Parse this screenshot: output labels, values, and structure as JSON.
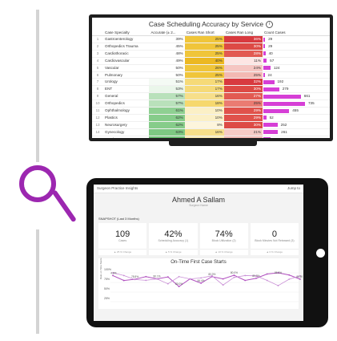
{
  "monitor": {
    "title": "Case Scheduling Accuracy by Service",
    "columns": [
      "Case Specialty",
      "Accurate (± 2...",
      "Cases Ran Short",
      "Cases Ran Long",
      "Count Cases"
    ],
    "rows": [
      {
        "idx": "1",
        "name": "Gastroenterology",
        "acc": "39%",
        "short": "25%",
        "long": "36%",
        "count": "29",
        "acc_c": "#ffffff",
        "short_c": "#f0c53a",
        "long_c": "#d83a3f",
        "bar": 0.04
      },
      {
        "idx": "2",
        "name": "Orthopedics Trauma",
        "acc": "45%",
        "short": "25%",
        "long": "30%",
        "count": "29",
        "acc_c": "#ffffff",
        "short_c": "#f0c53a",
        "long_c": "#dd4a45",
        "bar": 0.04
      },
      {
        "idx": "3",
        "name": "Cardiothoracic",
        "acc": "48%",
        "short": "25%",
        "long": "28%",
        "count": "40",
        "acc_c": "#ffffff",
        "short_c": "#f0c53a",
        "long_c": "#e25a52",
        "bar": 0.05
      },
      {
        "idx": "4",
        "name": "Cardiovascular",
        "acc": "49%",
        "short": "40%",
        "long": "11%",
        "count": "57",
        "acc_c": "#ffffff",
        "short_c": "#ecb822",
        "long_c": "#fde6e4",
        "bar": 0.08
      },
      {
        "idx": "5",
        "name": "Vascular",
        "short": "26%",
        "acc": "50%",
        "long": "24%",
        "count": "124",
        "acc_c": "#ffffff",
        "short_c": "#f0c53a",
        "long_c": "#f5c6c2",
        "bar": 0.17
      },
      {
        "idx": "6",
        "name": "Pulmonary",
        "acc": "50%",
        "short": "25%",
        "long": "25%",
        "count": "24",
        "acc_c": "#ffffff",
        "short_c": "#f0c53a",
        "long_c": "#f3b9b3",
        "bar": 0.03
      },
      {
        "idx": "7",
        "name": "Urology",
        "acc": "51%",
        "short": "17%",
        "long": "32%",
        "count": "192",
        "acc_c": "#f4faf4",
        "short_c": "#f6da78",
        "long_c": "#d83a3f",
        "bar": 0.26
      },
      {
        "idx": "8",
        "name": "ENT",
        "acc": "53%",
        "short": "17%",
        "long": "30%",
        "count": "279",
        "acc_c": "#eaf6ea",
        "short_c": "#f6da78",
        "long_c": "#dd4a45",
        "bar": 0.38
      },
      {
        "idx": "9",
        "name": "General",
        "acc": "57%",
        "short": "16%",
        "long": "27%",
        "count": "661",
        "acc_c": "#b9e1bb",
        "short_c": "#f7df8a",
        "long_c": "#e25a52",
        "bar": 0.9
      },
      {
        "idx": "10",
        "name": "Orthopedics",
        "acc": "57%",
        "short": "18%",
        "long": "25%",
        "count": "735",
        "acc_c": "#b9e1bb",
        "short_c": "#f6d86e",
        "long_c": "#ea7b72",
        "bar": 1.0
      },
      {
        "idx": "11",
        "name": "Ophthalmology",
        "acc": "61%",
        "short": "10%",
        "long": "29%",
        "count": "455",
        "acc_c": "#8fd092",
        "short_c": "#fbf0c6",
        "long_c": "#e0524b",
        "bar": 0.62
      },
      {
        "idx": "12",
        "name": "Plastics",
        "acc": "62%",
        "short": "10%",
        "long": "29%",
        "count": "52",
        "acc_c": "#86cc8a",
        "short_c": "#fbf0c6",
        "long_c": "#e0524b",
        "bar": 0.07
      },
      {
        "idx": "13",
        "name": "Neurosurgery",
        "acc": "62%",
        "short": "8%",
        "long": "30%",
        "count": "252",
        "acc_c": "#86cc8a",
        "short_c": "#fdf5dc",
        "long_c": "#dd4a45",
        "bar": 0.34
      },
      {
        "idx": "14",
        "name": "Gynecology",
        "acc": "63%",
        "short": "16%",
        "long": "21%",
        "count": "261",
        "acc_c": "#7dc882",
        "short_c": "#f7df8a",
        "long_c": "#f6cbc6",
        "bar": 0.35
      },
      {
        "idx": "15",
        "name": "Hand",
        "acc": "65%",
        "short": "12%",
        "long": "23%",
        "count": "124",
        "acc_c": "#6cc072",
        "short_c": "#faebb3",
        "long_c": "#f3b9b3",
        "bar": 0.17
      }
    ]
  },
  "tablet": {
    "app_title": "Surgeon Practice Insights",
    "top_right": "Jump to",
    "surgeon_name": "Ahmed A Sallam",
    "subtitle": "Surgeon Name",
    "snapshot": "SNAPSHOT (Last 3 Months)",
    "cards": [
      {
        "value": "109",
        "label": "Cases",
        "change": "▲ 25 % Change"
      },
      {
        "value": "42%",
        "label": "Scheduling Accuracy (1)",
        "change": "▲ 5 % Change"
      },
      {
        "value": "74%",
        "label": "Block Utilization (2)",
        "change": "▲ 10 % Change"
      },
      {
        "value": "0",
        "label": "Block Minutes Not Released (3)",
        "change": "▲ 0 % Change"
      }
    ],
    "chart": {
      "title": "On-Time First Case Starts",
      "ylabel": "Rate on Time Starts",
      "yticks": [
        "100%",
        "75%",
        "50%",
        "25%"
      ]
    }
  },
  "chart_data": {
    "type": "line",
    "title": "On-Time First Case Starts",
    "ylabel": "Rate on Time Starts",
    "ylim": [
      0,
      100
    ],
    "series": [
      {
        "values": [
          91,
          74.8,
          78.8,
          87.5,
          80.0,
          86.5,
          55.0,
          80.0,
          66.0,
          87.5,
          80.0,
          92.0,
          75.0,
          82.0,
          96.0,
          100,
          92.8,
          79.0
        ]
      },
      {
        "values": [
          100,
          91,
          78,
          75.3,
          80,
          64,
          87.5,
          80,
          83.3,
          90,
          60,
          85,
          91,
          90,
          75,
          58,
          79,
          90
        ]
      }
    ],
    "labels_first": [
      "74.8%",
      "78.8%",
      "80.1%",
      "80.0%",
      "84.4%",
      "80.0%",
      "80.0%",
      "89.3%",
      "86.5%",
      "92.8%"
    ]
  },
  "colors": {
    "accent": "#9c27b0",
    "bar": "#d63fd6"
  }
}
